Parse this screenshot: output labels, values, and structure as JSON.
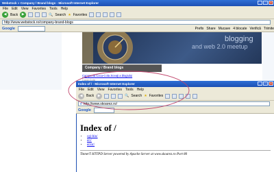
{
  "outer_window": {
    "title": "Webstock » Company / Brand blogs - Microsoft Internet Explorer",
    "menu": [
      "File",
      "Edit",
      "View",
      "Favorites",
      "Tools",
      "Help"
    ],
    "toolbar": {
      "back": "Back",
      "search": "Search",
      "favorites": "Favorites"
    },
    "address": "http://www.webstock.ro/company-brand-blogs",
    "google_right": [
      "Prefix",
      "Share",
      "Mucave",
      "4 blocate",
      "Verifică",
      "Trimite"
    ],
    "page": {
      "header_text_1": "blogging",
      "header_text_2": "and web 2.0 meetup",
      "section_title": "Company / Brand blogs",
      "link_text": "Campania Coca-Cola ziceaţi a blogiului",
      "sub_text": "Coca-Cola"
    }
  },
  "inner_window": {
    "title": "Index of / - Microsoft Internet Explorer",
    "menu": [
      "File",
      "Edit",
      "View",
      "Favorites",
      "Tools",
      "Help"
    ],
    "toolbar": {
      "back": "Back",
      "search": "Search",
      "favorites": "Favorites"
    },
    "address": "http://www.skoarez.ro/",
    "google_label": "Google",
    "page": {
      "heading": "Index of /",
      "links": [
        "cgi-bin/",
        "err/",
        "error/"
      ],
      "footer": "TinnerT HTTPD Server powered by Apache Server at www.skoarez.ro Port 80"
    }
  },
  "colors": {
    "titlebar": "#1c4fb3",
    "chrome": "#ece9d8",
    "annotation": "#c0456c",
    "section_bg": "#555555"
  }
}
